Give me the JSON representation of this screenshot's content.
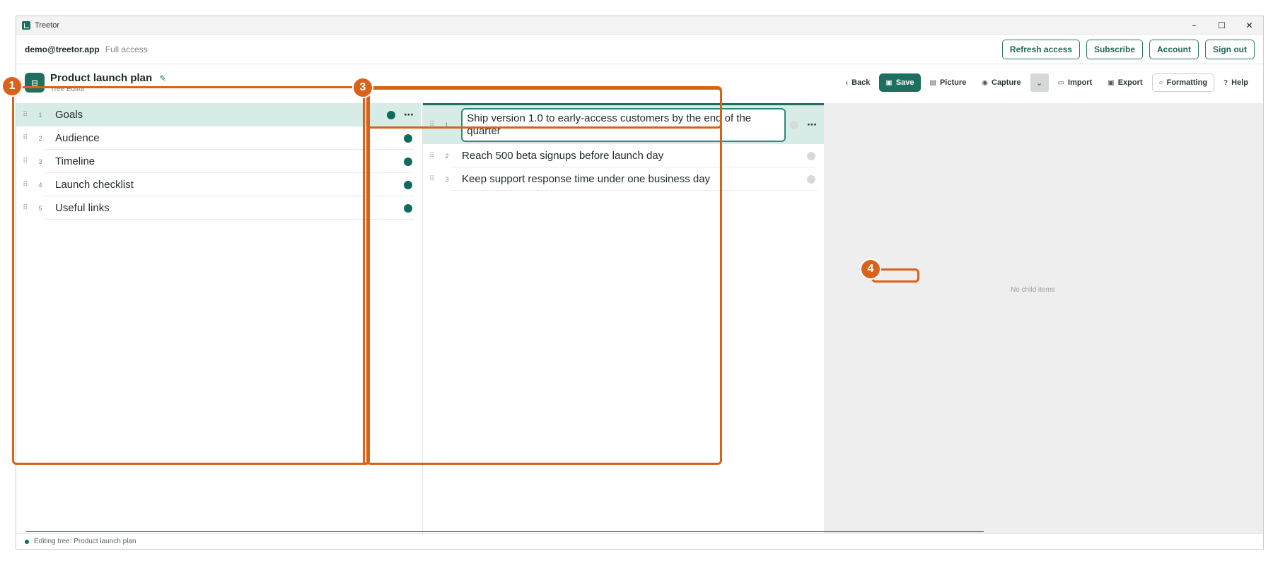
{
  "window": {
    "title": "Treetor",
    "min": "–",
    "max": "☐",
    "close": "✕"
  },
  "account": {
    "email": "demo@treetor.app",
    "access": "Full access",
    "buttons": [
      "Refresh access",
      "Subscribe",
      "Account",
      "Sign out"
    ]
  },
  "doc": {
    "icon": "tree-icon",
    "title": "Product launch plan",
    "subtitle": "Tree Editor"
  },
  "toolbar": {
    "back": "Back",
    "save": "Save",
    "picture": "Picture",
    "capture": "Capture",
    "import": "Import",
    "export": "Export",
    "formatting": "Formatting",
    "help": "Help"
  },
  "left_items": [
    {
      "num": "1",
      "label": "Goals"
    },
    {
      "num": "2",
      "label": "Audience"
    },
    {
      "num": "3",
      "label": "Timeline"
    },
    {
      "num": "4",
      "label": "Launch checklist"
    },
    {
      "num": "5",
      "label": "Useful links"
    }
  ],
  "mid_items": [
    {
      "num": "1",
      "label": "Ship version 1.0 to early-access customers by the end of the quarter"
    },
    {
      "num": "2",
      "label": "Reach 500 beta signups before launch day"
    },
    {
      "num": "3",
      "label": "Keep support response time under one business day"
    }
  ],
  "right": {
    "empty": "No child items"
  },
  "status": {
    "text": "Editing tree: Product launch plan"
  },
  "annotations": [
    "1",
    "3",
    "4"
  ],
  "colors": {
    "accent": "#1f6f60",
    "selected_row": "#d7ece7",
    "annotation": "#d9621a"
  }
}
